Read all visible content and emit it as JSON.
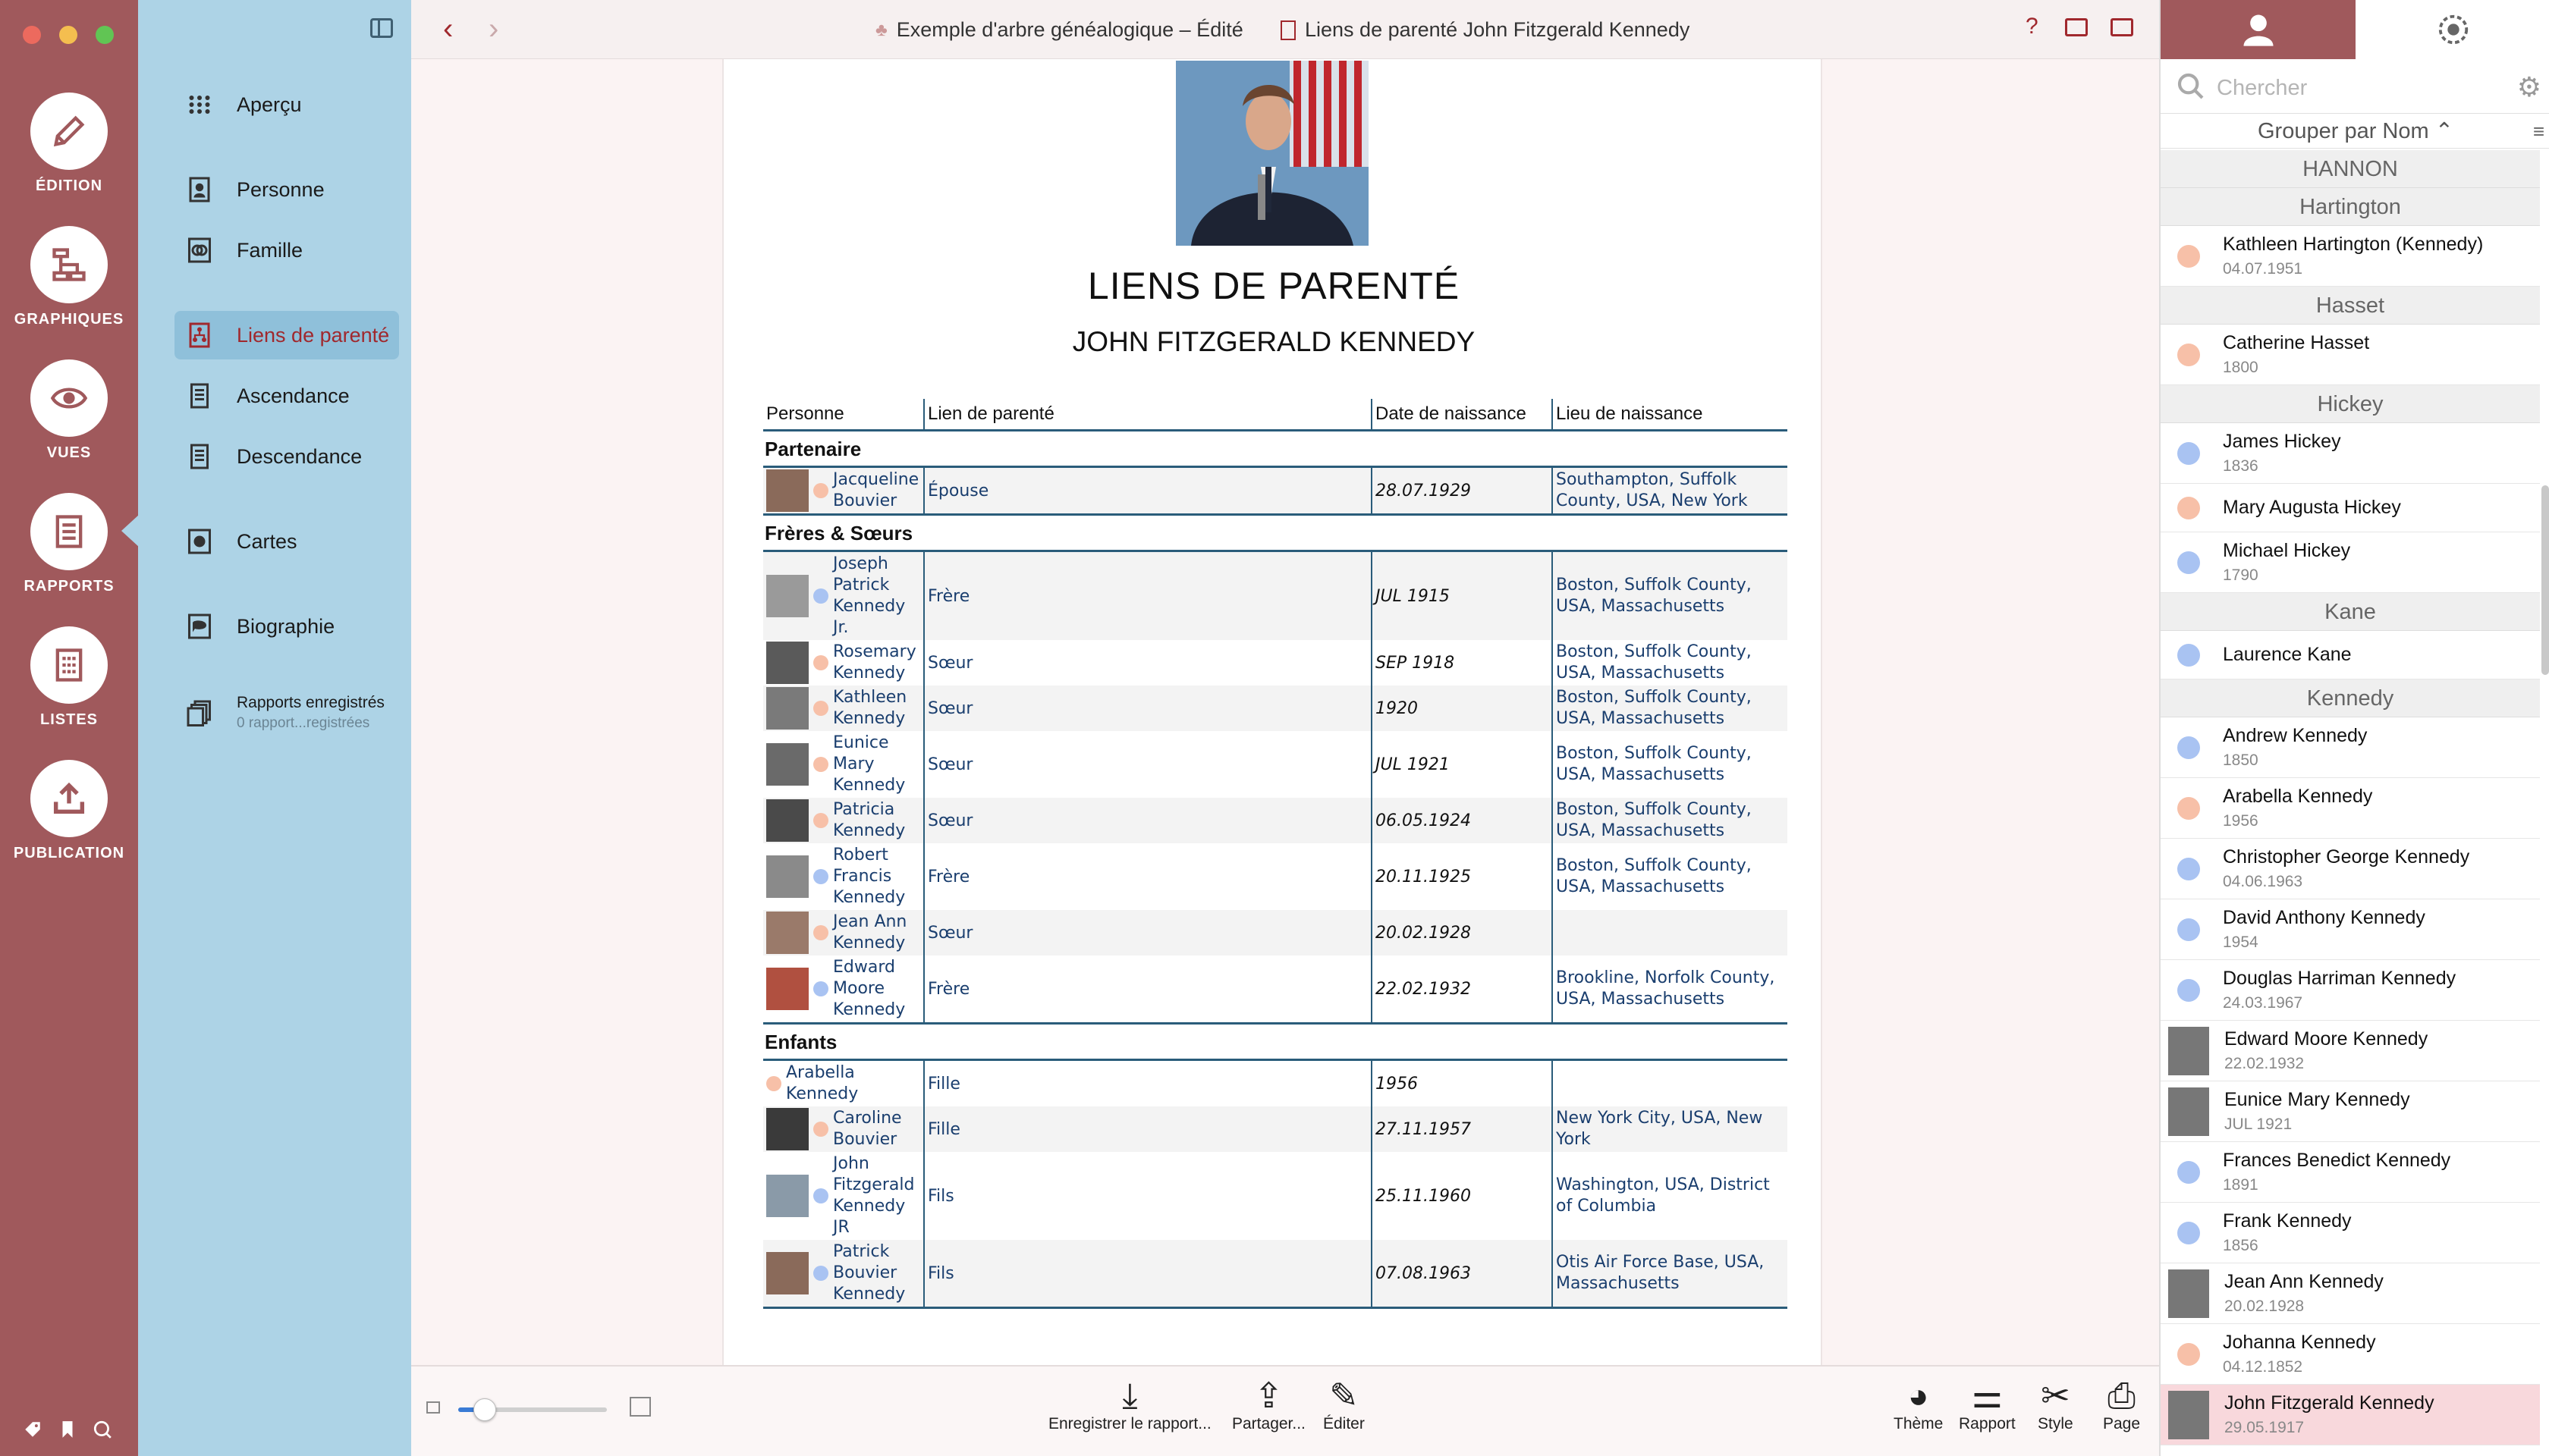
{
  "rail": {
    "items": [
      {
        "label": "ÉDITION",
        "icon": "pencil-icon"
      },
      {
        "label": "GRAPHIQUES",
        "icon": "chart-icon"
      },
      {
        "label": "VUES",
        "icon": "eye-icon"
      },
      {
        "label": "RAPPORTS",
        "icon": "report-icon"
      },
      {
        "label": "LISTES",
        "icon": "list-icon"
      },
      {
        "label": "PUBLICATION",
        "icon": "upload-icon"
      }
    ]
  },
  "nav": {
    "items": [
      {
        "label": "Aperçu",
        "icon": "grid-icon"
      },
      {
        "label": "Personne",
        "icon": "person-card-icon"
      },
      {
        "label": "Famille",
        "icon": "family-icon"
      },
      {
        "label": "Liens de parenté",
        "icon": "relationship-icon"
      },
      {
        "label": "Ascendance",
        "icon": "document-icon"
      },
      {
        "label": "Descendance",
        "icon": "document-icon"
      },
      {
        "label": "Cartes",
        "icon": "globe-icon"
      },
      {
        "label": "Biographie",
        "icon": "speech-icon"
      }
    ],
    "saved": {
      "title": "Rapports enregistrés",
      "subtitle": "0 rapport...registrées"
    }
  },
  "toolbar": {
    "doc_title": "Exemple d'arbre généalogique – Édité",
    "report_title": "Liens de parenté John Fitzgerald Kennedy",
    "help": "?"
  },
  "report": {
    "title": "LIENS DE PARENTÉ",
    "subtitle": "JOHN FITZGERALD KENNEDY",
    "columns": [
      "Personne",
      "Lien de parenté",
      "Date de naissance",
      "Lieu de naissance"
    ],
    "sections": [
      {
        "name": "Partenaire",
        "rows": [
          {
            "name": "Jacqueline Bouvier",
            "relation": "Épouse",
            "date": "28.07.1929",
            "place": "Southampton, Suffolk County, USA, New York",
            "sex": "f",
            "photo": true
          }
        ]
      },
      {
        "name": "Frères & Sœurs",
        "rows": [
          {
            "name": "Joseph Patrick Kennedy Jr.",
            "relation": "Frère",
            "date": "JUL 1915",
            "place": "Boston, Suffolk County, USA, Massachusetts",
            "sex": "m",
            "photo": true
          },
          {
            "name": "Rosemary Kennedy",
            "relation": "Sœur",
            "date": "SEP 1918",
            "place": "Boston, Suffolk County, USA, Massachusetts",
            "sex": "f",
            "photo": true
          },
          {
            "name": "Kathleen Kennedy",
            "relation": "Sœur",
            "date": "1920",
            "place": "Boston, Suffolk County, USA, Massachusetts",
            "sex": "f",
            "photo": true
          },
          {
            "name": "Eunice Mary Kennedy",
            "relation": "Sœur",
            "date": "JUL 1921",
            "place": "Boston, Suffolk County, USA, Massachusetts",
            "sex": "f",
            "photo": true
          },
          {
            "name": "Patricia Kennedy",
            "relation": "Sœur",
            "date": "06.05.1924",
            "place": "Boston, Suffolk County, USA, Massachusetts",
            "sex": "f",
            "photo": true
          },
          {
            "name": "Robert Francis Kennedy",
            "relation": "Frère",
            "date": "20.11.1925",
            "place": "Boston, Suffolk County, USA, Massachusetts",
            "sex": "m",
            "photo": true
          },
          {
            "name": "Jean Ann Kennedy",
            "relation": "Sœur",
            "date": "20.02.1928",
            "place": "",
            "sex": "f",
            "photo": true
          },
          {
            "name": "Edward Moore Kennedy",
            "relation": "Frère",
            "date": "22.02.1932",
            "place": "Brookline, Norfolk County, USA, Massachusetts",
            "sex": "m",
            "photo": true
          }
        ]
      },
      {
        "name": "Enfants",
        "rows": [
          {
            "name": "Arabella Kennedy",
            "relation": "Fille",
            "date": "1956",
            "place": "",
            "sex": "f",
            "photo": false
          },
          {
            "name": "Caroline Bouvier",
            "relation": "Fille",
            "date": "27.11.1957",
            "place": "New York City, USA, New York",
            "sex": "f",
            "photo": true
          },
          {
            "name": "John Fitzgerald Kennedy JR",
            "relation": "Fils",
            "date": "25.11.1960",
            "place": "Washington, USA, District of Columbia",
            "sex": "m",
            "photo": true
          },
          {
            "name": "Patrick Bouvier Kennedy",
            "relation": "Fils",
            "date": "07.08.1963",
            "place": "Otis Air Force Base, USA, Massachusetts",
            "sex": "m",
            "photo": true
          }
        ]
      }
    ]
  },
  "bottombar": {
    "buttons": [
      {
        "label": "Enregistrer le rapport...",
        "icon": "download-icon"
      },
      {
        "label": "Partager...",
        "icon": "share-icon"
      },
      {
        "label": "Éditer",
        "icon": "edit-icon"
      },
      {
        "label": "Thème",
        "icon": "palette-icon"
      },
      {
        "label": "Rapport",
        "icon": "toggles-icon"
      },
      {
        "label": "Style",
        "icon": "scissors-icon"
      },
      {
        "label": "Page",
        "icon": "page-settings-icon"
      }
    ]
  },
  "sidebar": {
    "search_placeholder": "Chercher",
    "group_by": "Grouper par Nom ⌃",
    "groups": [
      {
        "name": "HANNON",
        "people": []
      },
      {
        "name": "Hartington",
        "people": [
          {
            "name": "Kathleen Hartington (Kennedy)",
            "date": "04.07.1951",
            "sex": "f"
          }
        ]
      },
      {
        "name": "Hasset",
        "people": [
          {
            "name": "Catherine Hasset",
            "date": "1800",
            "sex": "f"
          }
        ]
      },
      {
        "name": "Hickey",
        "people": [
          {
            "name": "James Hickey",
            "date": "1836",
            "sex": "m"
          },
          {
            "name": "Mary Augusta Hickey",
            "date": "",
            "sex": "f"
          },
          {
            "name": "Michael Hickey",
            "date": "1790",
            "sex": "m"
          }
        ]
      },
      {
        "name": "Kane",
        "people": [
          {
            "name": "Laurence Kane",
            "date": "",
            "sex": "m"
          }
        ]
      },
      {
        "name": "Kennedy",
        "people": [
          {
            "name": "Andrew Kennedy",
            "date": "1850",
            "sex": "m"
          },
          {
            "name": "Arabella Kennedy",
            "date": "1956",
            "sex": "f"
          },
          {
            "name": "Christopher George Kennedy",
            "date": "04.06.1963",
            "sex": "m"
          },
          {
            "name": "David Anthony Kennedy",
            "date": "1954",
            "sex": "m"
          },
          {
            "name": "Douglas Harriman Kennedy",
            "date": "24.03.1967",
            "sex": "m"
          },
          {
            "name": "Edward Moore Kennedy",
            "date": "22.02.1932",
            "sex": "m",
            "photo": true
          },
          {
            "name": "Eunice Mary Kennedy",
            "date": "JUL 1921",
            "sex": "f",
            "photo": true
          },
          {
            "name": "Frances Benedict Kennedy",
            "date": "1891",
            "sex": "m"
          },
          {
            "name": "Frank Kennedy",
            "date": "1856",
            "sex": "m"
          },
          {
            "name": "Jean Ann Kennedy",
            "date": "20.02.1928",
            "sex": "f",
            "photo": true
          },
          {
            "name": "Johanna Kennedy",
            "date": "04.12.1852",
            "sex": "f"
          },
          {
            "name": "John Fitzgerald Kennedy",
            "date": "29.05.1917",
            "sex": "m",
            "photo": true,
            "selected": true
          }
        ]
      }
    ]
  },
  "colors": {
    "accent": "#a0595c",
    "nav_bg": "#add3e6",
    "male": "#a9c3f2",
    "female": "#f7c0a8",
    "link": "#1a3e6e"
  }
}
